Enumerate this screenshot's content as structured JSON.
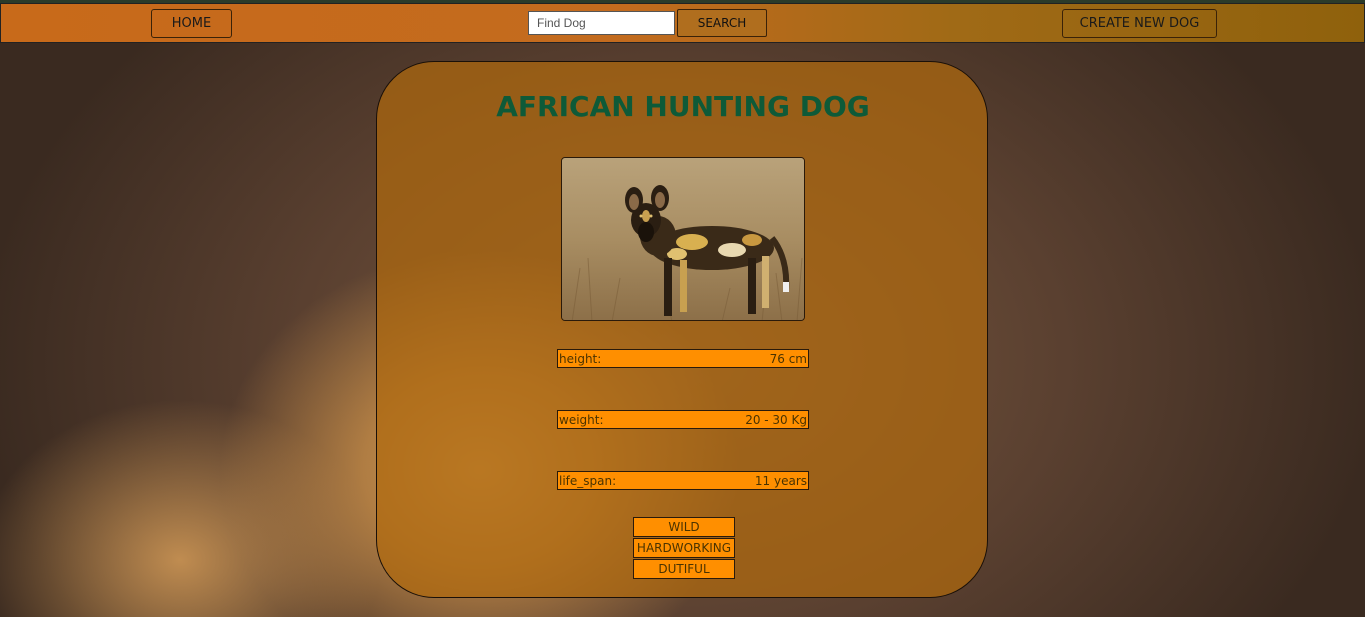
{
  "navbar": {
    "home_label": "HOME",
    "search_placeholder": "Find Dog",
    "search_value": "",
    "search_label": "SEARCH",
    "create_label": "CREATE NEW DOG"
  },
  "dog": {
    "name": "AFRICAN HUNTING DOG",
    "stats": [
      {
        "label": "height:",
        "value": "76 cm"
      },
      {
        "label": "weight:",
        "value": "20 - 30 Kg"
      },
      {
        "label": "life_span:",
        "value": "11 years"
      }
    ],
    "temperaments": [
      "WILD",
      "HARDWORKING",
      "DUTIFUL"
    ]
  },
  "colors": {
    "navbar_orange": "#c86a1a",
    "title_green": "#0e5a38",
    "stat_orange": "#ff8f00"
  }
}
